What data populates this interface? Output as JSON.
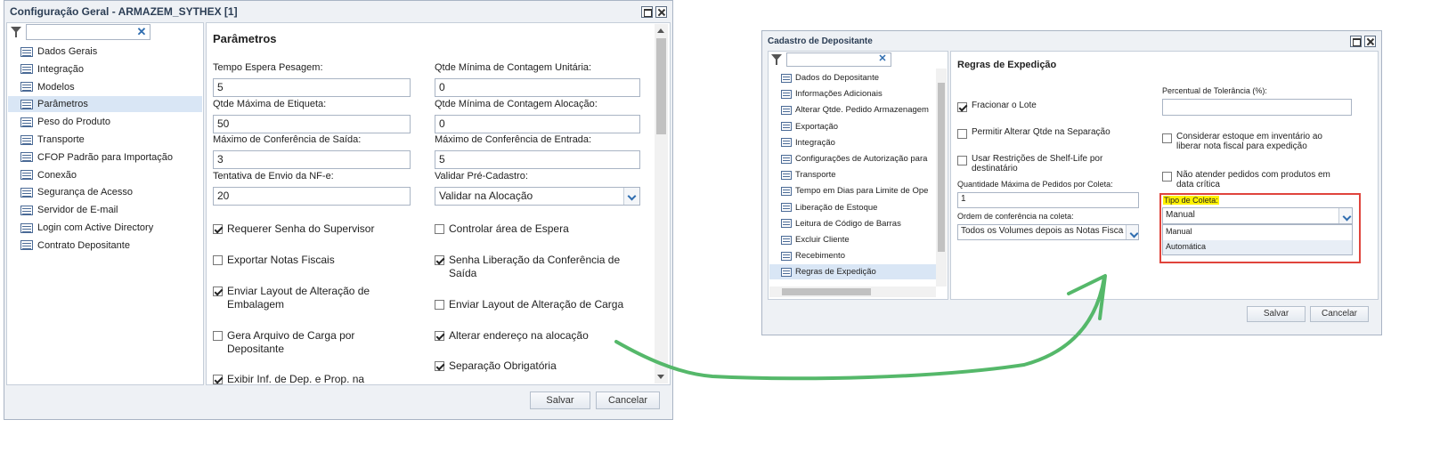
{
  "window1": {
    "title": "Configuração Geral - ARMAZEM_SYTHEX [1]",
    "nav": [
      "Dados Gerais",
      "Integração",
      "Modelos",
      "Parâmetros",
      "Peso do Produto",
      "Transporte",
      "CFOP Padrão para Importação",
      "Conexão",
      "Segurança de Acesso",
      "Servidor de E-mail",
      "Login com Active Directory",
      "Contrato Depositante"
    ],
    "selected_nav": "Parâmetros",
    "section_title": "Parâmetros",
    "fields": [
      {
        "label": "Tempo Espera Pesagem:",
        "value": "5"
      },
      {
        "label": "Qtde Mínima de Contagem Unitária:",
        "value": "0"
      },
      {
        "label": "Qtde Máxima de Etiqueta:",
        "value": "50"
      },
      {
        "label": "Qtde Mínima de Contagem Alocação:",
        "value": "0"
      },
      {
        "label": "Máximo de Conferência de Saída:",
        "value": "3"
      },
      {
        "label": "Máximo de Conferência de Entrada:",
        "value": "5"
      },
      {
        "label": "Tentativa de Envio da NF-e:",
        "value": "20"
      },
      {
        "label": "Validar Pré-Cadastro:",
        "value": "Validar na Alocação"
      }
    ],
    "checkboxes": [
      {
        "label": "Requerer Senha do Supervisor",
        "checked": true
      },
      {
        "label": "Controlar área de Espera",
        "checked": false
      },
      {
        "label": "Exportar Notas Fiscais",
        "checked": false
      },
      {
        "label": "Senha Liberação da Conferência de Saída",
        "checked": true
      },
      {
        "label": "Enviar Layout de Alteração de Embalagem",
        "checked": true
      },
      {
        "label": "Enviar Layout de Alteração de Carga",
        "checked": false
      },
      {
        "label": "Gera Arquivo de Carga por Depositante",
        "checked": false
      },
      {
        "label": "Alterar endereço na alocação",
        "checked": true
      },
      {
        "label": "Exibir Inf. de Dep. e Prop. na",
        "checked": true
      },
      {
        "label": "Separação Obrigatória",
        "checked": true
      }
    ],
    "save_label": "Salvar",
    "cancel_label": "Cancelar"
  },
  "window2": {
    "title": "Cadastro de Depositante",
    "nav": [
      "Dados do Depositante",
      "Informações Adicionais",
      "Alterar Qtde. Pedido Armazenagem",
      "Exportação",
      "Integração",
      "Configurações de Autorização para",
      "Transporte",
      "Tempo em Dias para Limite de Ope",
      "Liberação de Estoque",
      "Leitura de Código de Barras",
      "Excluir Cliente",
      "Recebimento",
      "Regras de Expedição"
    ],
    "selected_nav": "Regras de Expedição",
    "section_title": "Regras de Expedição",
    "checkboxes": [
      {
        "label": "Fracionar o Lote",
        "checked": true
      },
      {
        "label": "Permitir Alterar Qtde na Separação",
        "checked": false
      },
      {
        "label": "Usar Restrições de Shelf-Life por destinatário",
        "checked": false
      },
      {
        "label": "Considerar estoque em inventário ao liberar nota fiscal para expedição",
        "checked": false
      },
      {
        "label": "Não atender pedidos com produtos em data crítica",
        "checked": false
      }
    ],
    "fields": {
      "qtd_label": "Quantidade Máxima de Pedidos por Coleta:",
      "qtd_value": "1",
      "ordem_label": "Ordem de conferência na coleta:",
      "ordem_value": "Todos os Volumes depois as Notas Fisca",
      "tolerancia_label": "Percentual de Tolerância (%):",
      "tolerancia_value": "",
      "tipo_label": "Tipo de Coleta:",
      "tipo_value": "Manual",
      "tipo_options": [
        "Manual",
        "Automática"
      ]
    },
    "save_label": "Salvar",
    "cancel_label": "Cancelar"
  },
  "colors": {
    "highlight_box": "#e0443c",
    "label_highlight": "#fff200",
    "arrow": "#55b86a"
  }
}
